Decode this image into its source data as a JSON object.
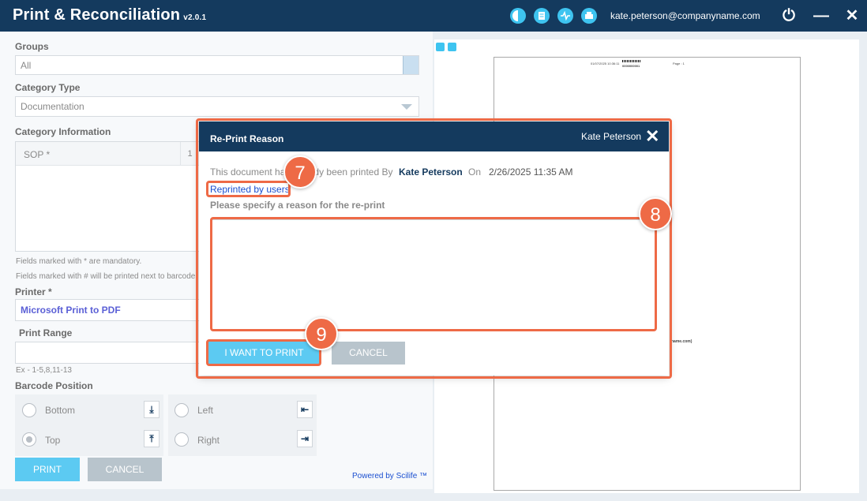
{
  "window": {
    "title": "Print & Reconciliation",
    "version": "v2.0.1",
    "user_email": "kate.peterson@companyname.com",
    "icons": [
      "theme-icon",
      "document-icon",
      "activity-icon",
      "printer-icon"
    ],
    "power_icon": "⏻",
    "minimize_icon": "—",
    "close_icon": "✕"
  },
  "form": {
    "groups_label": "Groups",
    "groups_value": "All",
    "category_type_label": "Category Type",
    "category_type_value": "Documentation",
    "category_info_label": "Category Information",
    "sop_label": "SOP *",
    "sop_count": "1",
    "note_mandatory": "Fields marked with * are mandatory.",
    "note_barcode": "Fields marked with # will be printed next to barcode",
    "printer_label": "Printer *",
    "printer_value": "Microsoft Print to PDF",
    "print_range_label": "Print Range",
    "print_range_value": "",
    "print_range_hint": "Ex - 1-5,8,11-13",
    "barcode_position_label": "Barcode Position",
    "positions": {
      "bottom": "Bottom",
      "top": "Top",
      "left": "Left",
      "right": "Right",
      "selected": "Top"
    },
    "print_button": "PRINT",
    "cancel_button": "CANCEL",
    "powered_by": "Powered by Scilife ™"
  },
  "preview": {
    "header_date": "01/07/2025 10:36:11",
    "header_barcode": "0000000001",
    "header_page": "Page : 1",
    "email_fragment": "name.com)"
  },
  "dialog": {
    "title": "Re-Print Reason",
    "user": "Kate Peterson",
    "close_icon": "✕",
    "message_prefix": "This document has already been printed By",
    "printed_by": "Kate Peterson",
    "on_label": "On",
    "printed_at": "2/26/2025 11:35 AM",
    "reprinted_link": "Reprinted by users",
    "reason_label": "Please specify a reason for the re-print",
    "reason_value": "",
    "confirm_button": "I WANT TO PRINT",
    "cancel_button": "CANCEL"
  },
  "annotations": {
    "badge_7": "7",
    "badge_8": "8",
    "badge_9": "9",
    "color": "#ee6a46"
  }
}
